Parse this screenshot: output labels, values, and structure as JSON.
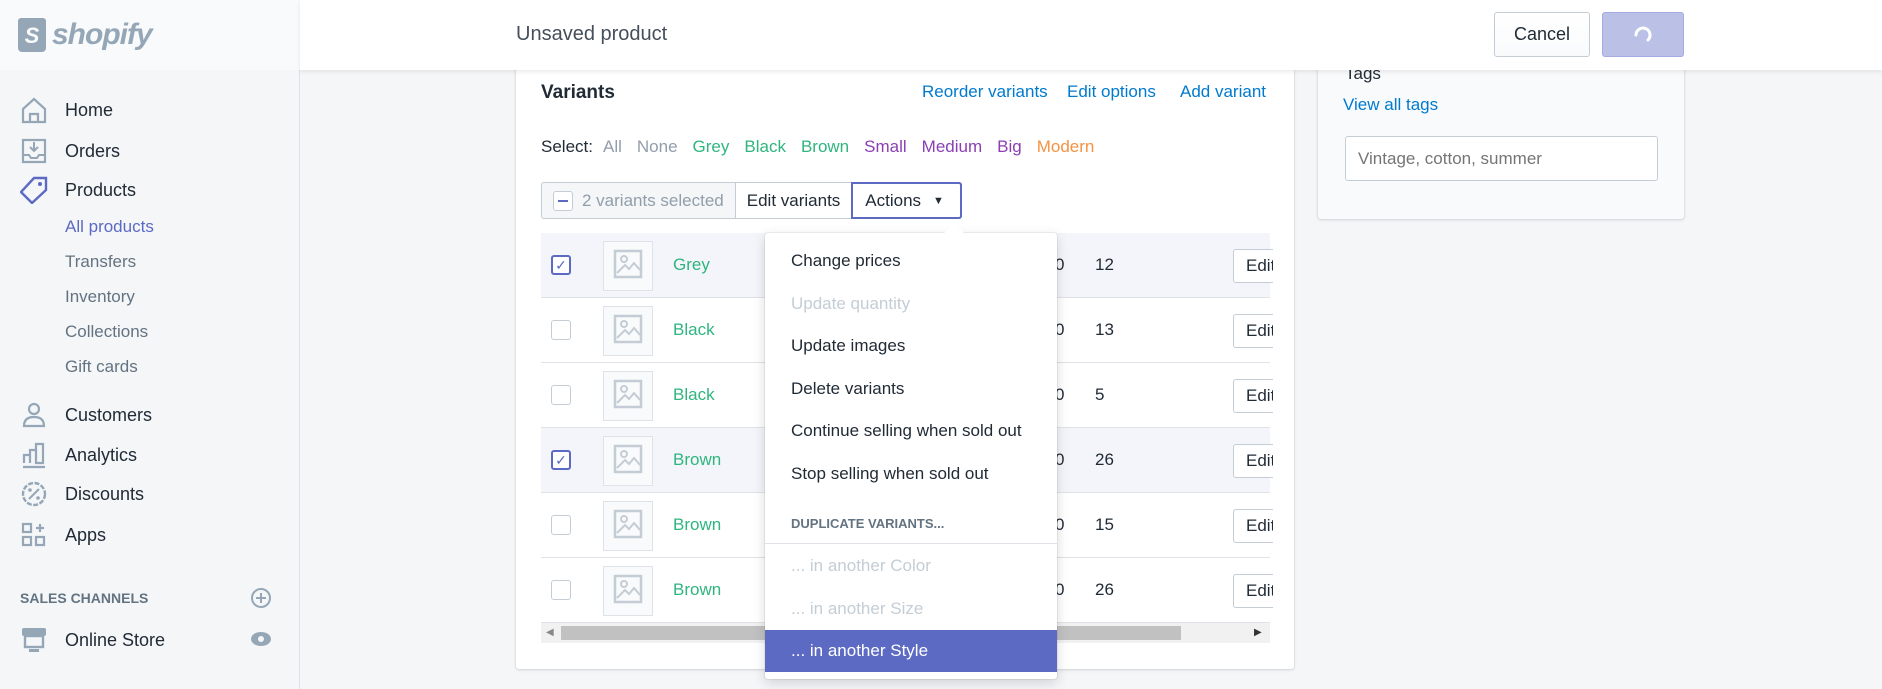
{
  "brand": {
    "name": "shopify",
    "logo_letter": "S"
  },
  "header": {
    "title": "Unsaved product",
    "cancel_label": "Cancel",
    "save_state": "loading"
  },
  "sidebar": {
    "items": [
      {
        "label": "Home",
        "icon": "home-icon"
      },
      {
        "label": "Orders",
        "icon": "orders-icon"
      },
      {
        "label": "Products",
        "icon": "tag-icon"
      },
      {
        "label": "Customers",
        "icon": "person-icon"
      },
      {
        "label": "Analytics",
        "icon": "bar-chart-icon"
      },
      {
        "label": "Discounts",
        "icon": "discount-icon"
      },
      {
        "label": "Apps",
        "icon": "apps-icon"
      }
    ],
    "product_sub": [
      "All products",
      "Transfers",
      "Inventory",
      "Collections",
      "Gift cards"
    ],
    "sales_channels_label": "SALES CHANNELS",
    "online_store": "Online Store"
  },
  "variants": {
    "title": "Variants",
    "links": [
      "Reorder variants",
      "Edit options",
      "Add variant"
    ],
    "select_label": "Select:",
    "select_options": [
      {
        "label": "All",
        "color": "#919eab"
      },
      {
        "label": "None",
        "color": "#919eab"
      },
      {
        "label": "Grey",
        "color": "#2fb57e"
      },
      {
        "label": "Black",
        "color": "#2fb57e"
      },
      {
        "label": "Brown",
        "color": "#2fb57e"
      },
      {
        "label": "Small",
        "color": "#8a3fb5"
      },
      {
        "label": "Medium",
        "color": "#8a3fb5"
      },
      {
        "label": "Big",
        "color": "#8a3fb5"
      },
      {
        "label": "Modern",
        "color": "#f49342"
      }
    ],
    "bulk": {
      "selected": "2 variants selected",
      "edit": "Edit variants",
      "actions": "Actions"
    },
    "rows": [
      {
        "name": "Grey",
        "price_tail": "0",
        "qty": "12",
        "checked": true,
        "edit": "Edit"
      },
      {
        "name": "Black",
        "price_tail": "0",
        "qty": "13",
        "checked": false,
        "edit": "Edit"
      },
      {
        "name": "Black",
        "price_tail": "0",
        "qty": "5",
        "checked": false,
        "edit": "Edit"
      },
      {
        "name": "Brown",
        "price_tail": "0",
        "qty": "26",
        "checked": true,
        "edit": "Edit"
      },
      {
        "name": "Brown",
        "price_tail": "0",
        "qty": "15",
        "checked": false,
        "edit": "Edit"
      },
      {
        "name": "Brown",
        "price_tail": "0",
        "qty": "26",
        "checked": false,
        "edit": "Edit"
      }
    ]
  },
  "actions_menu": {
    "items": [
      "Change prices",
      "Update quantity",
      "Update images",
      "Delete variants",
      "Continue selling when sold out",
      "Stop selling when sold out"
    ],
    "section": "DUPLICATE VARIANTS...",
    "dup_items": [
      "... in another Color",
      "... in another Size",
      "... in another Style"
    ],
    "highlight_color": "#5c6ac4"
  },
  "tags": {
    "title": "Tags",
    "view_all": "View all tags",
    "placeholder": "Vintage, cotton, summer"
  }
}
